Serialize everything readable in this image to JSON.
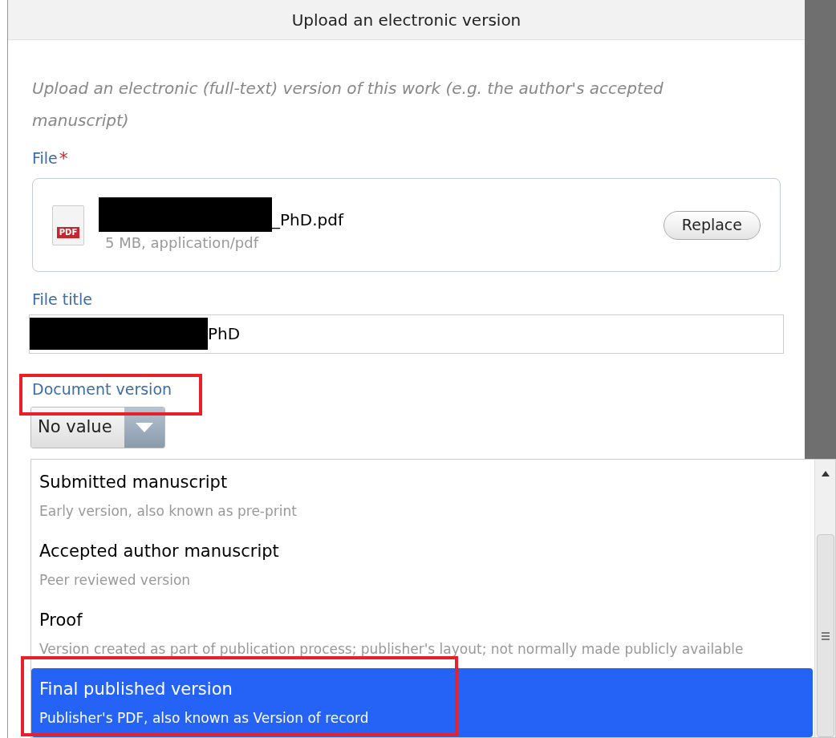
{
  "dialog": {
    "title": "Upload an electronic version",
    "description": "Upload an electronic (full-text) version of this work (e.g. the author's accepted manuscript)",
    "file": {
      "label": "File",
      "required_mark": "*",
      "badge": "PDF",
      "name": "_PhD.pdf",
      "meta": "5 MB, application/pdf",
      "button": "Replace"
    },
    "file_title": {
      "label": "File title",
      "value": "PhD"
    },
    "document_version": {
      "label": "Document version",
      "value": "No value"
    }
  },
  "dropdown": {
    "options": [
      {
        "title": "Submitted manuscript",
        "subtitle": "Early version, also known as pre-print",
        "selected": false
      },
      {
        "title": "Accepted author manuscript",
        "subtitle": "Peer reviewed version",
        "selected": false
      },
      {
        "title": "Proof",
        "subtitle": "Version created as part of publication process; publisher's layout; not normally made publicly available",
        "selected": false
      },
      {
        "title": "Final published version",
        "subtitle": "Publisher's PDF, also known as Version of record",
        "selected": true
      }
    ]
  }
}
